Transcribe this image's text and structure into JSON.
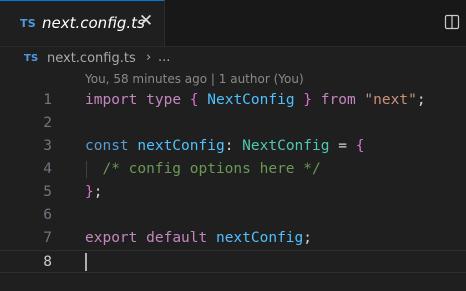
{
  "tab": {
    "badge": "TS",
    "title": "next.config.ts",
    "close": "✕"
  },
  "breadcrumb": {
    "badge": "TS",
    "file": "next.config.ts",
    "separator": "›",
    "more": "..."
  },
  "blame": "You, 58 minutes ago | 1 author (You)",
  "icons": {
    "split_editor": "split-editor-icon",
    "close": "close-icon"
  },
  "colors": {
    "accent": "#0078d4",
    "keyword": "#c586c0",
    "declaration": "#569cd6",
    "type": "#4ec9b0",
    "variable": "#4fc1ff",
    "string": "#ce9178",
    "comment": "#6a9955"
  },
  "code_lines": [
    {
      "number": "1",
      "tokens": [
        {
          "t": "import",
          "k": "kw"
        },
        {
          "t": " ",
          "k": "punc"
        },
        {
          "t": "type",
          "k": "kw"
        },
        {
          "t": " ",
          "k": "punc"
        },
        {
          "t": "{",
          "k": "brace"
        },
        {
          "t": " ",
          "k": "punc"
        },
        {
          "t": "NextConfig",
          "k": "var"
        },
        {
          "t": " ",
          "k": "punc"
        },
        {
          "t": "}",
          "k": "brace"
        },
        {
          "t": " ",
          "k": "punc"
        },
        {
          "t": "from",
          "k": "kw"
        },
        {
          "t": " ",
          "k": "punc"
        },
        {
          "t": "\"next\"",
          "k": "str"
        },
        {
          "t": ";",
          "k": "semi"
        }
      ]
    },
    {
      "number": "2",
      "tokens": []
    },
    {
      "number": "3",
      "tokens": [
        {
          "t": "const",
          "k": "decl"
        },
        {
          "t": " ",
          "k": "punc"
        },
        {
          "t": "nextConfig",
          "k": "var"
        },
        {
          "t": ": ",
          "k": "punc"
        },
        {
          "t": "NextConfig",
          "k": "type"
        },
        {
          "t": " = ",
          "k": "punc"
        },
        {
          "t": "{",
          "k": "brace"
        }
      ]
    },
    {
      "number": "4",
      "tokens": [
        {
          "t": "  ",
          "k": "punc"
        },
        {
          "t": "/* config options here */",
          "k": "comment"
        }
      ]
    },
    {
      "number": "5",
      "tokens": [
        {
          "t": "}",
          "k": "brace"
        },
        {
          "t": ";",
          "k": "semi"
        }
      ]
    },
    {
      "number": "6",
      "tokens": []
    },
    {
      "number": "7",
      "tokens": [
        {
          "t": "export",
          "k": "kw"
        },
        {
          "t": " ",
          "k": "punc"
        },
        {
          "t": "default",
          "k": "kw"
        },
        {
          "t": " ",
          "k": "punc"
        },
        {
          "t": "nextConfig",
          "k": "var"
        },
        {
          "t": ";",
          "k": "semi"
        }
      ]
    },
    {
      "number": "8",
      "tokens": []
    }
  ]
}
